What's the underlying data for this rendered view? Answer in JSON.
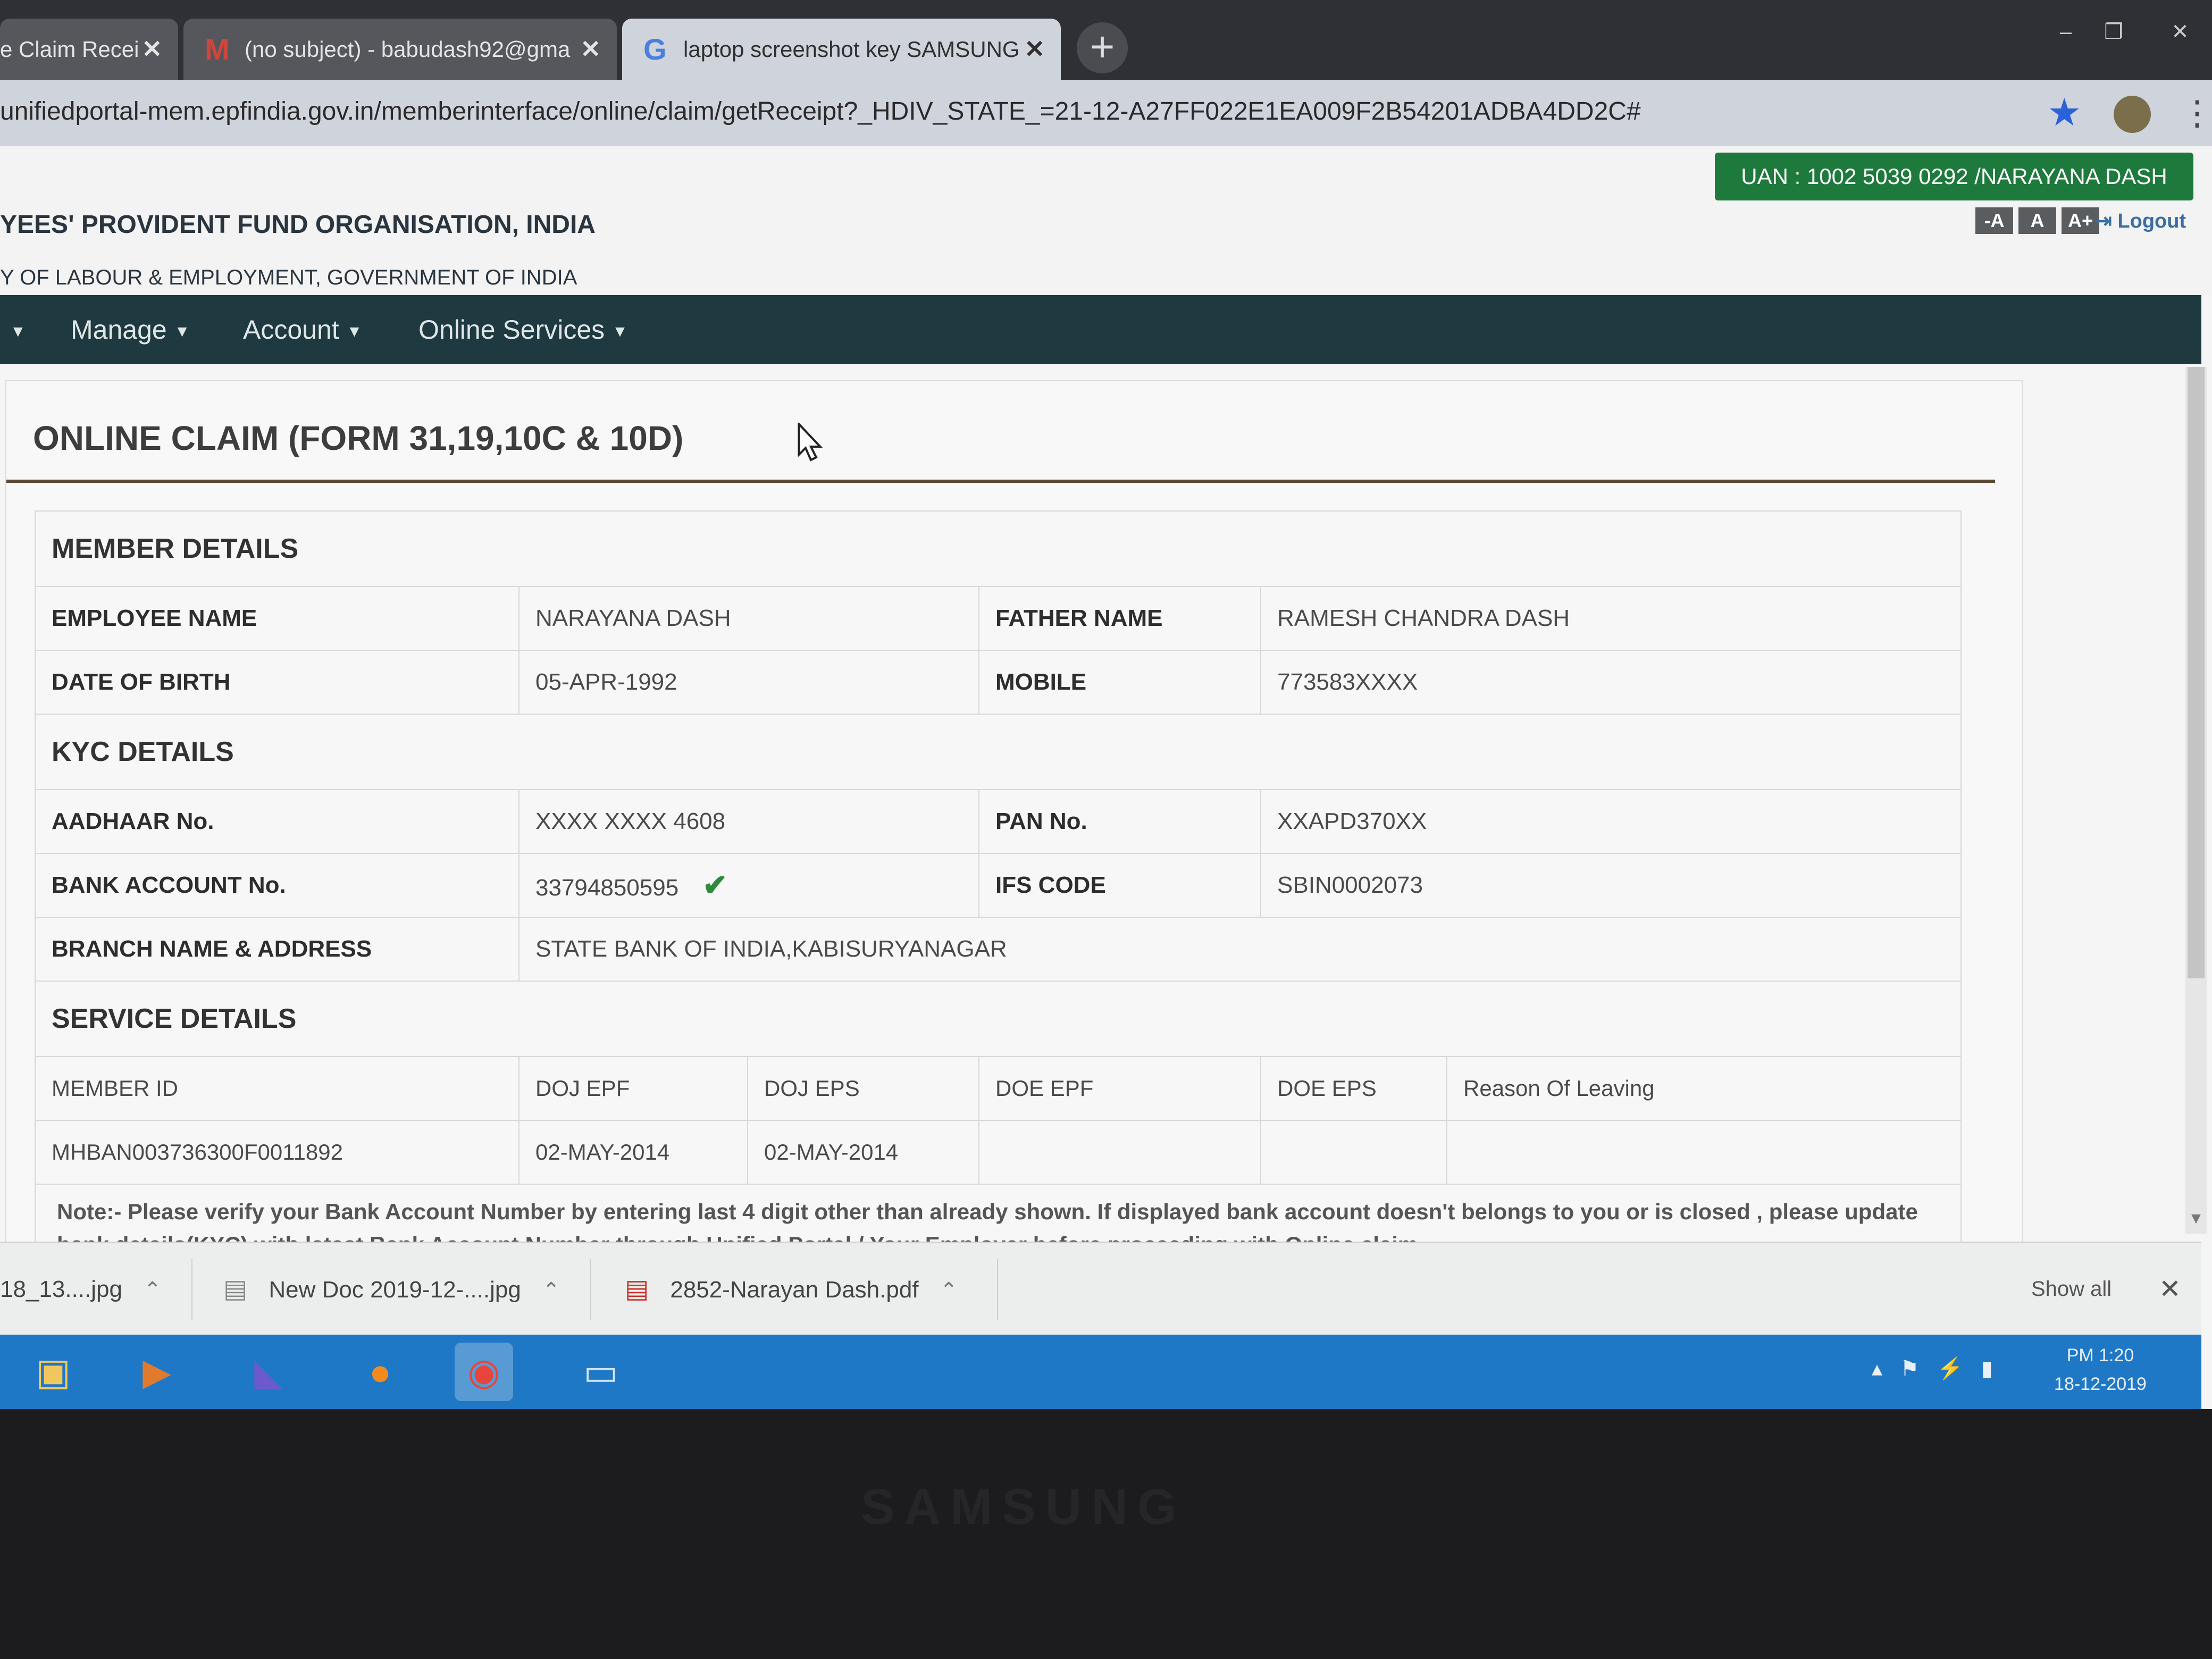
{
  "browser": {
    "tabs": [
      {
        "label": "e Claim Recei",
        "icon": ""
      },
      {
        "label": "(no subject) - babudash92@gma",
        "icon": "M"
      },
      {
        "label": "laptop screenshot key SAMSUNG",
        "icon": "G"
      }
    ],
    "new_tab": "+",
    "url": "unifiedportal-mem.epfindia.gov.in/memberinterface/online/claim/getReceipt?_HDIV_STATE_=21-12-A27FF022E1EA009F2B54201ADBA4DD2C#",
    "window_controls": {
      "minimize": "–",
      "restore": "❐",
      "close": "✕"
    }
  },
  "header": {
    "uan": "UAN : 1002 5039 0292 /NARAYANA DASH",
    "font_buttons": [
      "-A",
      "A",
      "A+"
    ],
    "logout": "Logout",
    "org_line1": "YEES' PROVIDENT FUND ORGANISATION, INDIA",
    "org_line2": "Y OF LABOUR & EMPLOYMENT, GOVERNMENT OF INDIA"
  },
  "nav": {
    "items": [
      "Manage",
      "Account",
      "Online Services"
    ]
  },
  "claim": {
    "title": "ONLINE CLAIM (FORM 31,19,10C & 10D)",
    "member_details": {
      "heading": "MEMBER DETAILS",
      "employee_name_label": "EMPLOYEE NAME",
      "employee_name": "NARAYANA DASH",
      "father_name_label": "FATHER NAME",
      "father_name": "RAMESH CHANDRA DASH",
      "dob_label": "DATE OF BIRTH",
      "dob": "05-APR-1992",
      "mobile_label": "MOBILE",
      "mobile": "773583XXXX"
    },
    "kyc_details": {
      "heading": "KYC DETAILS",
      "aadhaar_label": "AADHAAR No.",
      "aadhaar": "XXXX XXXX 4608",
      "pan_label": "PAN No.",
      "pan": "XXAPD370XX",
      "bank_account_label": "BANK ACCOUNT No.",
      "bank_account": "33794850595",
      "ifs_label": "IFS CODE",
      "ifs": "SBIN0002073",
      "branch_label": "BRANCH NAME & ADDRESS",
      "branch": "STATE BANK OF INDIA,KABISURYANAGAR"
    },
    "service_details": {
      "heading": "SERVICE DETAILS",
      "columns": [
        "MEMBER ID",
        "DOJ EPF",
        "DOJ EPS",
        "DOE EPF",
        "DOE EPS",
        "Reason Of Leaving"
      ],
      "rows": [
        [
          "MHBAN003736300F0011892",
          "02-MAY-2014",
          "02-MAY-2014",
          "",
          "",
          ""
        ]
      ]
    },
    "note": "Note:- Please verify your Bank Account Number by entering last 4 digit other than already shown. If displayed bank account doesn't belongs to you or is closed , please update bank details(KYC) with latest Bank Account Number through Unified Portal / Your Employer before proceeding with Online claim."
  },
  "downloads": {
    "items": [
      "18_13....jpg",
      "New Doc 2019-12-....jpg",
      "2852-Narayan Dash.pdf"
    ],
    "show_all": "Show all"
  },
  "taskbar": {
    "time": "PM 1:20",
    "date": "18-12-2019"
  },
  "bezel": {
    "brand": "SAMSUNG"
  },
  "colors": {
    "nav_bg": "#1e3940",
    "uan_bg": "#1e7a3c",
    "taskbar_bg": "#1f78c6",
    "check": "#2e8b3a"
  }
}
